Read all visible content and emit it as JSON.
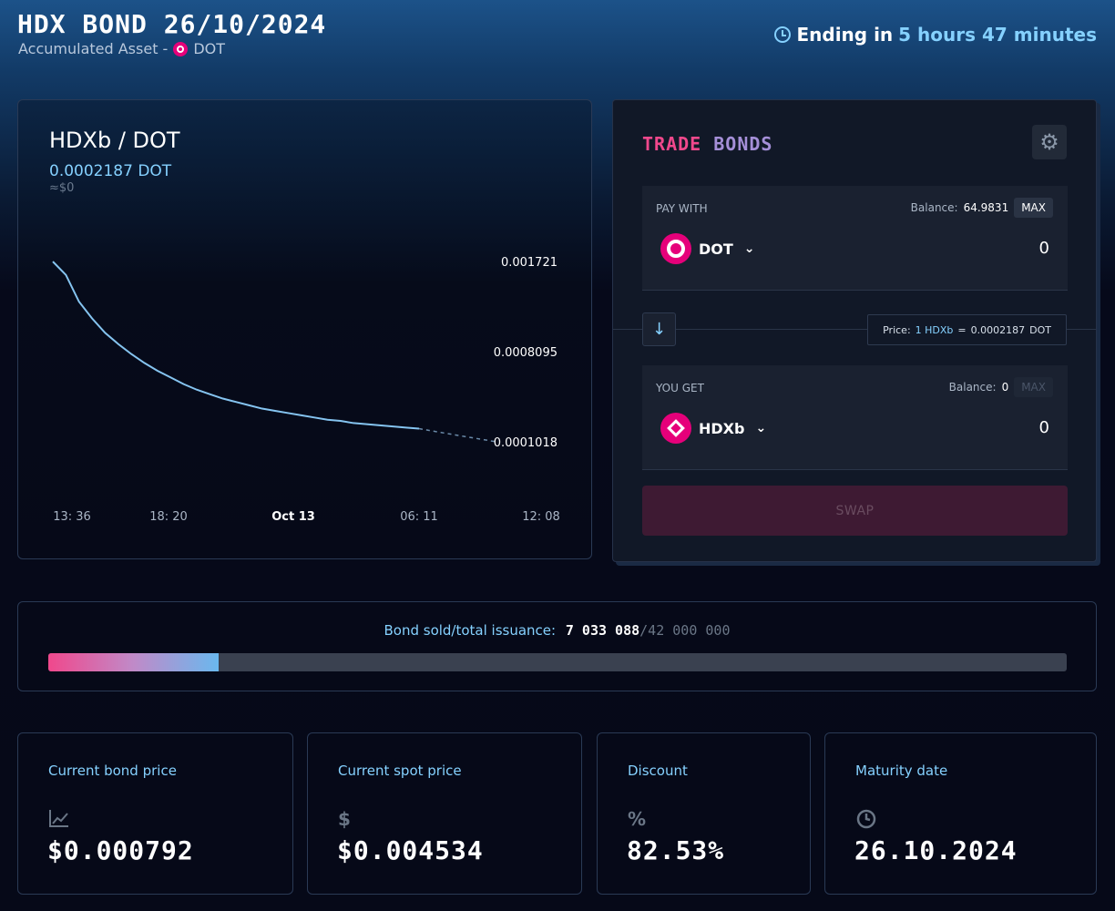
{
  "header": {
    "title": "HDX BOND 26/10/2024",
    "subtitle_prefix": "Accumulated Asset -",
    "subtitle_asset": "DOT",
    "ending_prefix": "Ending in",
    "ending_time": "5 hours 47 minutes"
  },
  "chart": {
    "pair": "HDXb / DOT",
    "price": "0.0002187 DOT",
    "usd": "≈$0"
  },
  "chart_data": {
    "type": "line",
    "title": "",
    "y_ticks": [
      "0.001721",
      "0.0008095",
      "0.0001018"
    ],
    "x_ticks": [
      "13: 36",
      "18: 20",
      "Oct 13",
      "06: 11",
      "12: 08"
    ],
    "series": [
      {
        "values": [
          0.00172,
          0.0016,
          0.00136,
          0.00121,
          0.00108,
          0.00098,
          0.00089,
          0.00081,
          0.00074,
          0.00068,
          0.00062,
          0.00057,
          0.00053,
          0.00049,
          0.00046,
          0.00043,
          0.0004,
          0.00038,
          0.00036,
          0.00034,
          0.00032,
          0.0003,
          0.00029,
          0.00027,
          0.00026,
          0.00025,
          0.00024,
          0.00023,
          0.00022
        ],
        "projection": [
          0.00022,
          0.00016,
          0.000102
        ]
      }
    ],
    "grid": false
  },
  "trade": {
    "title_a": "TRADE",
    "title_b": "BONDS",
    "pay_label": "PAY WITH",
    "pay_balance_label": "Balance:",
    "pay_balance": "64.9831",
    "max_label": "MAX",
    "pay_asset": "DOT",
    "pay_amount": "0",
    "price_label": "Price:",
    "price_lhs": "1 HDXb",
    "price_eq": "=",
    "price_rhs": "0.0002187",
    "price_unit": "DOT",
    "get_label": "YOU GET",
    "get_balance_label": "Balance:",
    "get_balance": "0",
    "get_asset": "HDXb",
    "get_amount": "0",
    "swap_label": "SWAP"
  },
  "progress": {
    "label": "Bond sold/total issuance:",
    "sold": "7 033 088",
    "total": "/42 000 000",
    "fraction": 0.1675
  },
  "stats": [
    {
      "label": "Current bond price",
      "value": "$0.000792",
      "icon": "chart-icon"
    },
    {
      "label": "Current spot price",
      "value": "$0.004534",
      "icon": "dollar-icon"
    },
    {
      "label": "Discount",
      "value": "82.53%",
      "icon": "percent-icon"
    },
    {
      "label": "Maturity date",
      "value": "26.10.2024",
      "icon": "clock-icon"
    }
  ]
}
